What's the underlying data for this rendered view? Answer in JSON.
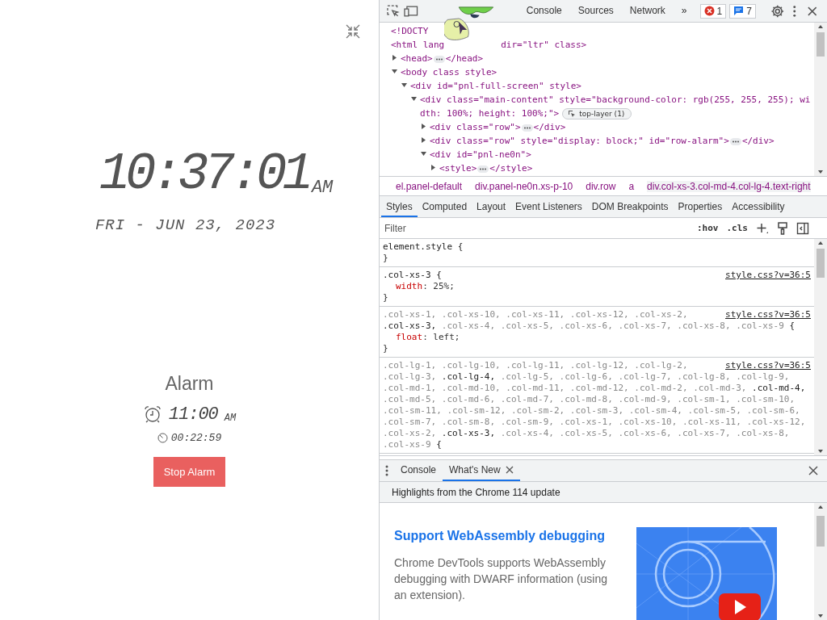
{
  "clock": {
    "time": "10:37:01",
    "meridiem": "AM",
    "date": "FRI - JUN 23, 2023"
  },
  "alarm": {
    "title": "Alarm",
    "time": "11:00",
    "meridiem": "AM",
    "countdown": "00:22:59",
    "button": "Stop Alarm"
  },
  "devtools": {
    "tabs": [
      {
        "label": "Console",
        "selected": false
      },
      {
        "label": "Sources",
        "selected": false
      },
      {
        "label": "Network",
        "selected": false
      }
    ],
    "more_tabs": "»",
    "errors": "1",
    "messages": "7",
    "dom_tree": [
      {
        "open": "<!DOCTY"
      },
      {
        "open": "<html lang",
        "open_after": "dir=\"ltr\" class>",
        "children": [
          {
            "open": "<head>",
            "close": "</head>",
            "expanded": false
          },
          {
            "open": "<body class style>",
            "expanded": true,
            "children": [
              {
                "open": "<div id=\"pnl-full-screen\" style>",
                "expanded": true,
                "children": [
                  {
                    "open": "<div class=\"main-content\" style=\"background-color: rgb(255, 255, 255); wi",
                    "open_wrap": "dth: 100%; height: 100%;\">",
                    "badge": "top-layer (1)",
                    "expanded": true,
                    "children": [
                      {
                        "open": "<div class=\"row\">",
                        "close": "</div>",
                        "expanded": false
                      },
                      {
                        "open": "<div class=\"row\" style=\"display: block;\" id=\"row-alarm\">",
                        "close": "</div>",
                        "expanded": false
                      },
                      {
                        "open": "<div id=\"pnl-ne0n\">",
                        "expanded": true,
                        "children": [
                          {
                            "open": "<style>",
                            "close": "</style>",
                            "expanded": false
                          }
                        ]
                      }
                    ]
                  }
                ]
              }
            ]
          }
        ]
      }
    ],
    "breadcrumbs": [
      {
        "label": "el.panel-default",
        "selected": false
      },
      {
        "label": "div.panel-ne0n.xs-p-10",
        "selected": false
      },
      {
        "label": "div.row",
        "selected": false
      },
      {
        "label": "a",
        "selected": false
      },
      {
        "label": "div.col-xs-3.col-md-4.col-lg-4.text-right",
        "selected": true
      }
    ],
    "style_tabs": [
      {
        "label": "Styles",
        "selected": true
      },
      {
        "label": "Computed",
        "selected": false
      },
      {
        "label": "Layout",
        "selected": false
      },
      {
        "label": "Event Listeners",
        "selected": false
      },
      {
        "label": "DOM Breakpoints",
        "selected": false
      },
      {
        "label": "Properties",
        "selected": false
      },
      {
        "label": "Accessibility",
        "selected": false
      }
    ],
    "filter": {
      "placeholder": "Filter"
    },
    "hov": ":hov",
    "cls": ".cls",
    "rules": [
      {
        "selectors": [
          {
            "text": "element.style",
            "matched": true
          }
        ],
        "open": "{",
        "close": "}"
      },
      {
        "source": "style.css?v=36:5",
        "selectors": [
          {
            "text": ".col-xs-3",
            "matched": true
          }
        ],
        "open": "{",
        "properties": [
          {
            "name": "width",
            "value": ": 25%;"
          }
        ],
        "close": "}"
      },
      {
        "source": "style.css?v=36:5",
        "selectors": [
          {
            "text": ".col-xs-1,",
            "matched": false
          },
          {
            "text": ".col-xs-10,",
            "matched": false
          },
          {
            "text": ".col-xs-11,",
            "matched": false
          },
          {
            "text": ".col-xs-12,",
            "matched": false
          },
          {
            "text": ".col-xs-2,",
            "matched": false
          },
          {
            "text": ".col-xs-3,",
            "matched": true
          },
          {
            "text": ".col-xs-4,",
            "matched": false
          },
          {
            "text": ".col-xs-5,",
            "matched": false
          },
          {
            "text": ".col-xs-6,",
            "matched": false
          },
          {
            "text": ".col-xs-7,",
            "matched": false
          },
          {
            "text": ".col-xs-8,",
            "matched": false
          },
          {
            "text": ".col-xs-9",
            "matched": false
          }
        ],
        "open": "{",
        "properties": [
          {
            "name": "float",
            "value": ": left;"
          }
        ],
        "close": "}"
      },
      {
        "source": "style.css?v=36:5",
        "selectors": [
          {
            "text": ".col-lg-1,",
            "matched": false
          },
          {
            "text": ".col-lg-10,",
            "matched": false
          },
          {
            "text": ".col-lg-11,",
            "matched": false
          },
          {
            "text": ".col-lg-12,",
            "matched": false
          },
          {
            "text": ".col-lg-2,",
            "matched": false
          },
          {
            "text": ".col-lg-3,",
            "matched": false
          },
          {
            "text": ".col-lg-4,",
            "matched": true
          },
          {
            "text": ".col-lg-5,",
            "matched": false
          },
          {
            "text": ".col-lg-6,",
            "matched": false
          },
          {
            "text": ".col-lg-7,",
            "matched": false
          },
          {
            "text": ".col-lg-8,",
            "matched": false
          },
          {
            "text": ".col-lg-9,",
            "matched": false
          },
          {
            "text": ".col-md-1,",
            "matched": false
          },
          {
            "text": ".col-md-10,",
            "matched": false
          },
          {
            "text": ".col-md-11,",
            "matched": false
          },
          {
            "text": ".col-md-12,",
            "matched": false
          },
          {
            "text": ".col-md-2,",
            "matched": false
          },
          {
            "text": ".col-md-3,",
            "matched": false
          },
          {
            "text": ".col-md-4,",
            "matched": true
          },
          {
            "text": ".col-md-5,",
            "matched": false
          },
          {
            "text": ".col-md-6,",
            "matched": false
          },
          {
            "text": ".col-md-7,",
            "matched": false
          },
          {
            "text": ".col-md-8,",
            "matched": false
          },
          {
            "text": ".col-md-9,",
            "matched": false
          },
          {
            "text": ".col-sm-1,",
            "matched": false
          },
          {
            "text": ".col-sm-10,",
            "matched": false
          },
          {
            "text": ".col-sm-11,",
            "matched": false
          },
          {
            "text": ".col-sm-12,",
            "matched": false
          },
          {
            "text": ".col-sm-2,",
            "matched": false
          },
          {
            "text": ".col-sm-3,",
            "matched": false
          },
          {
            "text": ".col-sm-4,",
            "matched": false
          },
          {
            "text": ".col-sm-5,",
            "matched": false
          },
          {
            "text": ".col-sm-6,",
            "matched": false
          },
          {
            "text": ".col-sm-7,",
            "matched": false
          },
          {
            "text": ".col-sm-8,",
            "matched": false
          },
          {
            "text": ".col-sm-9,",
            "matched": false
          },
          {
            "text": ".col-xs-1,",
            "matched": false
          },
          {
            "text": ".col-xs-10,",
            "matched": false
          },
          {
            "text": ".col-xs-11,",
            "matched": false
          },
          {
            "text": ".col-xs-12,",
            "matched": false
          },
          {
            "text": ".col-xs-2,",
            "matched": false
          },
          {
            "text": ".col-xs-3,",
            "matched": true
          },
          {
            "text": ".col-xs-4,",
            "matched": false
          },
          {
            "text": ".col-xs-5,",
            "matched": false
          },
          {
            "text": ".col-xs-6,",
            "matched": false
          },
          {
            "text": ".col-xs-7,",
            "matched": false
          },
          {
            "text": ".col-xs-8,",
            "matched": false
          },
          {
            "text": ".col-xs-9",
            "matched": false
          }
        ],
        "open": "{"
      }
    ],
    "drawer_tabs": [
      {
        "label": "Console",
        "selected": false
      },
      {
        "label": "What's New",
        "selected": true,
        "closable": true
      }
    ],
    "highlights": "Highlights from the Chrome 114 update",
    "article": {
      "heading": "Support WebAssembly debugging",
      "body": "Chrome DevTools supports WebAssembly debugging with DWARF information (using an extension)."
    }
  }
}
